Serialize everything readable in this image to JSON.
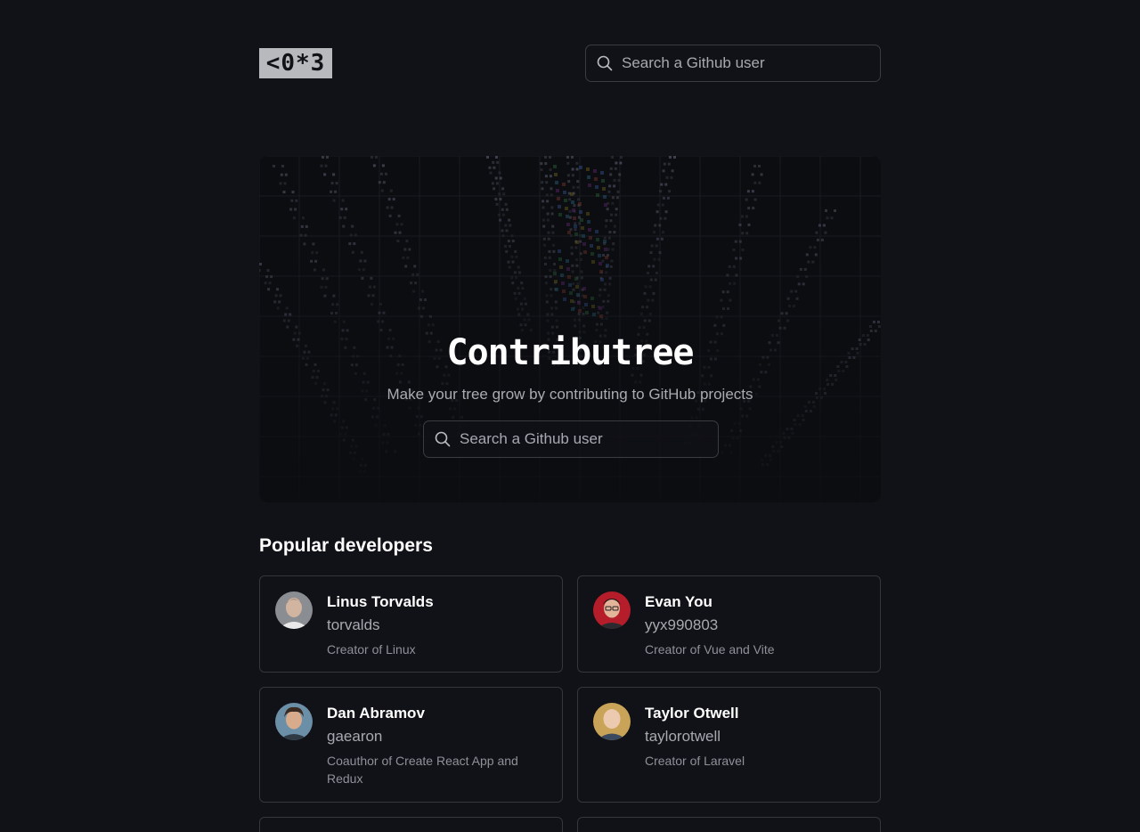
{
  "header": {
    "logo_text": "<0*3",
    "search_placeholder": "Search a Github user"
  },
  "hero": {
    "title": "Contributree",
    "subtitle": "Make your tree grow by contributing to GitHub projects",
    "search_placeholder": "Search a Github user"
  },
  "developers": {
    "title": "Popular developers",
    "items": [
      {
        "name": "Linus Torvalds",
        "handle": "torvalds",
        "description": "Creator of Linux"
      },
      {
        "name": "Evan You",
        "handle": "yyx990803",
        "description": "Creator of Vue and Vite"
      },
      {
        "name": "Dan Abramov",
        "handle": "gaearon",
        "description": "Coauthor of Create React App and Redux"
      },
      {
        "name": "Taylor Otwell",
        "handle": "taylorotwell",
        "description": "Creator of Laravel"
      }
    ]
  },
  "colors": {
    "background": "#111217",
    "card_border": "#34363d",
    "text_primary": "#ffffff",
    "text_secondary": "#a7a9b0",
    "logo_background": "#b8b9bc"
  }
}
